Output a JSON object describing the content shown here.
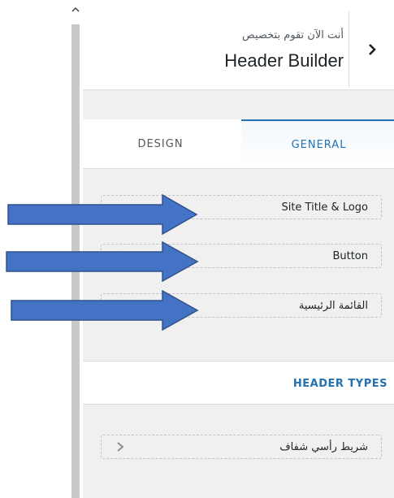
{
  "header": {
    "subtitle": "أنت الآن تقوم بتخصيص",
    "title": "Header Builder"
  },
  "tabs": [
    {
      "label": "DESIGN",
      "active": false
    },
    {
      "label": "GENERAL",
      "active": true
    }
  ],
  "items": [
    {
      "label": "Site Title & Logo"
    },
    {
      "label": "Button"
    },
    {
      "label": "القائمة الرئيسية"
    }
  ],
  "section": {
    "label": "HEADER TYPES"
  },
  "header_types": [
    {
      "label": "شريط رأسي شفاف"
    }
  ],
  "colors": {
    "accent": "#2271b1",
    "arrow_fill": "#4472c4",
    "arrow_stroke": "#2f528f"
  }
}
